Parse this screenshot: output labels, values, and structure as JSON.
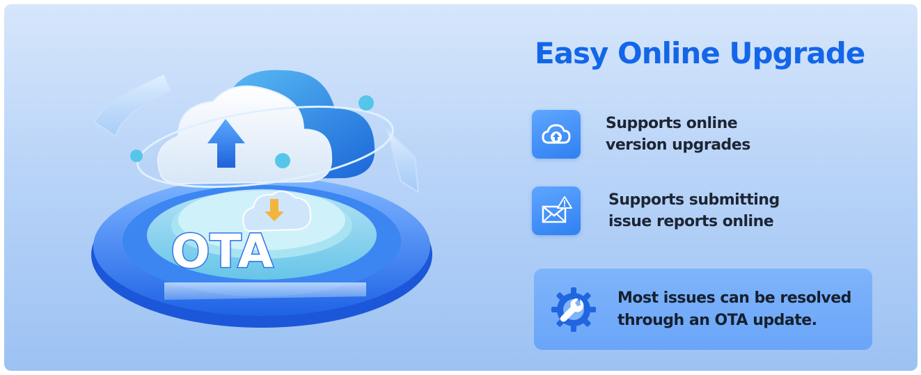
{
  "title": "Easy Online Upgrade",
  "illustration": {
    "label": "OTA"
  },
  "features": [
    {
      "icon": "cloud-upload-icon",
      "lines": [
        "Supports online",
        "version upgrades"
      ]
    },
    {
      "icon": "mail-warning-icon",
      "lines": [
        "Supports submitting",
        "issue reports online"
      ]
    }
  ],
  "note": {
    "icon": "gear-wrench-icon",
    "lines": [
      "Most issues can be resolved",
      "through an OTA update."
    ]
  },
  "colors": {
    "accent": "#1466e8",
    "icon_bg": "#3d8cf5",
    "note_bg": "#74acf9"
  }
}
